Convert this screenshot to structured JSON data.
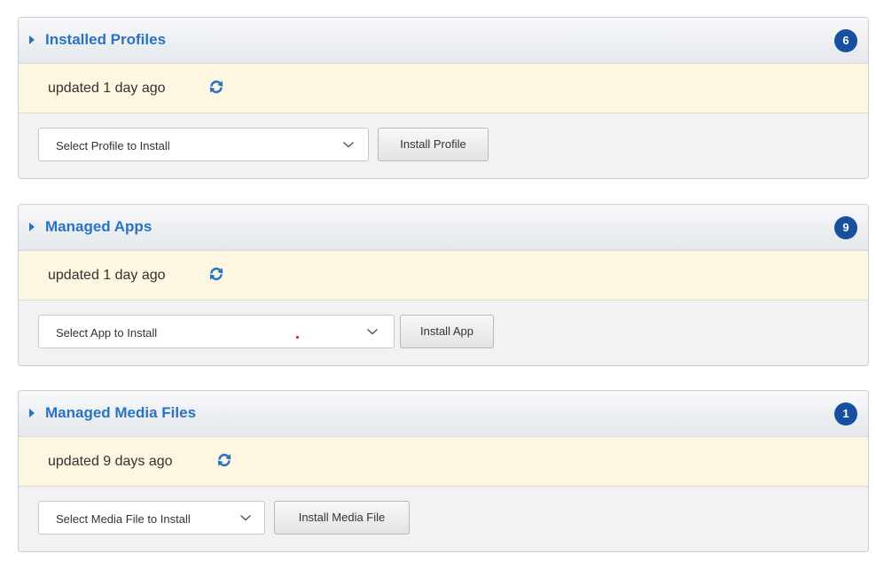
{
  "panels": [
    {
      "title": "Installed Profiles",
      "count": "6",
      "status": "updated 1 day ago",
      "select_placeholder": "Select Profile to Install",
      "button_label": "Install Profile"
    },
    {
      "title": "Managed Apps",
      "count": "9",
      "status": "updated 1 day ago",
      "select_placeholder": "Select App to Install",
      "button_label": "Install App"
    },
    {
      "title": "Managed Media Files",
      "count": "1",
      "status": "updated 9 days ago",
      "select_placeholder": "Select Media File to Install",
      "button_label": "Install Media File"
    }
  ],
  "icons": {
    "expand": "caret-right-icon",
    "refresh": "refresh-icon",
    "dropdown": "chevron-down-icon"
  },
  "colors": {
    "title": "#2a72c4",
    "badge": "#17509e",
    "status_background": "#fdf6e1",
    "refresh": "#2a72c4"
  }
}
